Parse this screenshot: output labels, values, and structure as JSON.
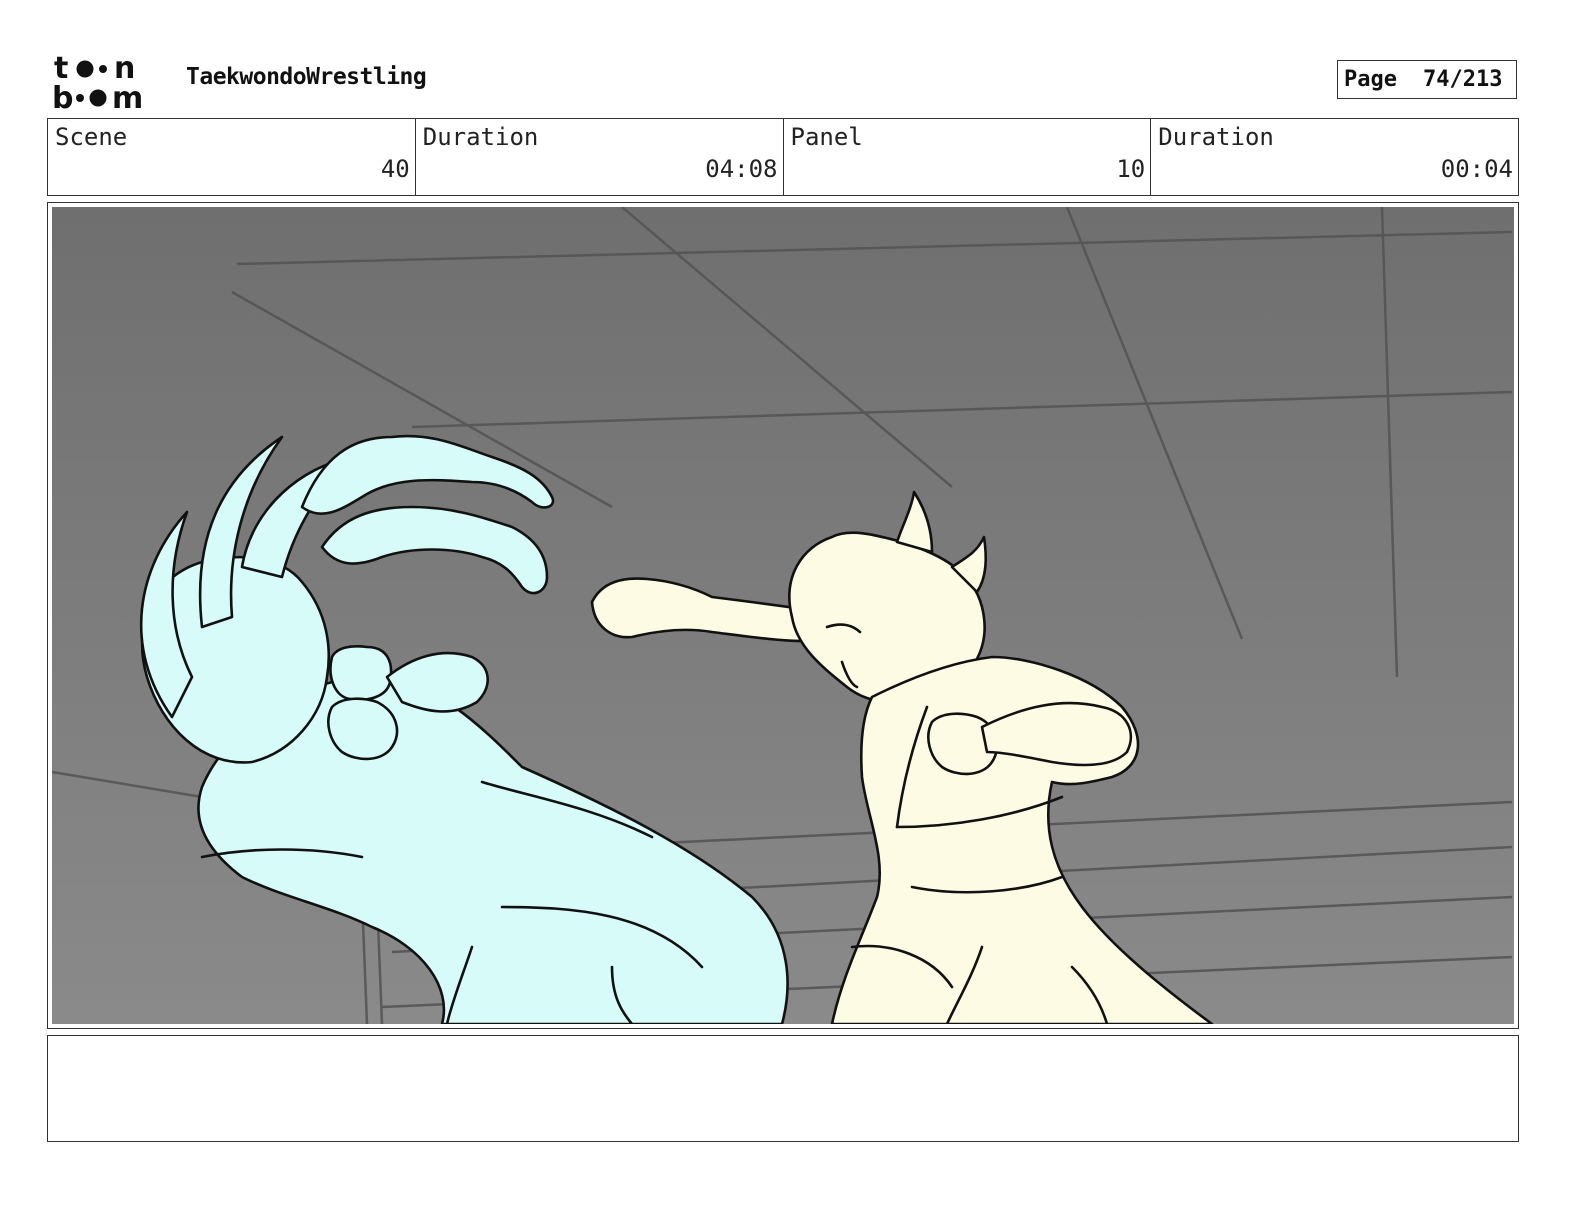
{
  "header": {
    "logo_text_top": "toon",
    "logo_text_bottom": "boom",
    "project_title": "TaekwondoWrestling",
    "page_label": "Page",
    "page_number": "74/213"
  },
  "info": {
    "scene_label": "Scene",
    "scene_value": "40",
    "scene_duration_label": "Duration",
    "scene_duration_value": "04:08",
    "panel_label": "Panel",
    "panel_value": "10",
    "panel_duration_label": "Duration",
    "panel_duration_value": "00:04"
  },
  "panel": {
    "background_color": "#777777",
    "left_character_color": "#d6fbf9",
    "right_character_color": "#fdfbe4",
    "line_color": "#111111"
  },
  "notes": {
    "text": ""
  }
}
